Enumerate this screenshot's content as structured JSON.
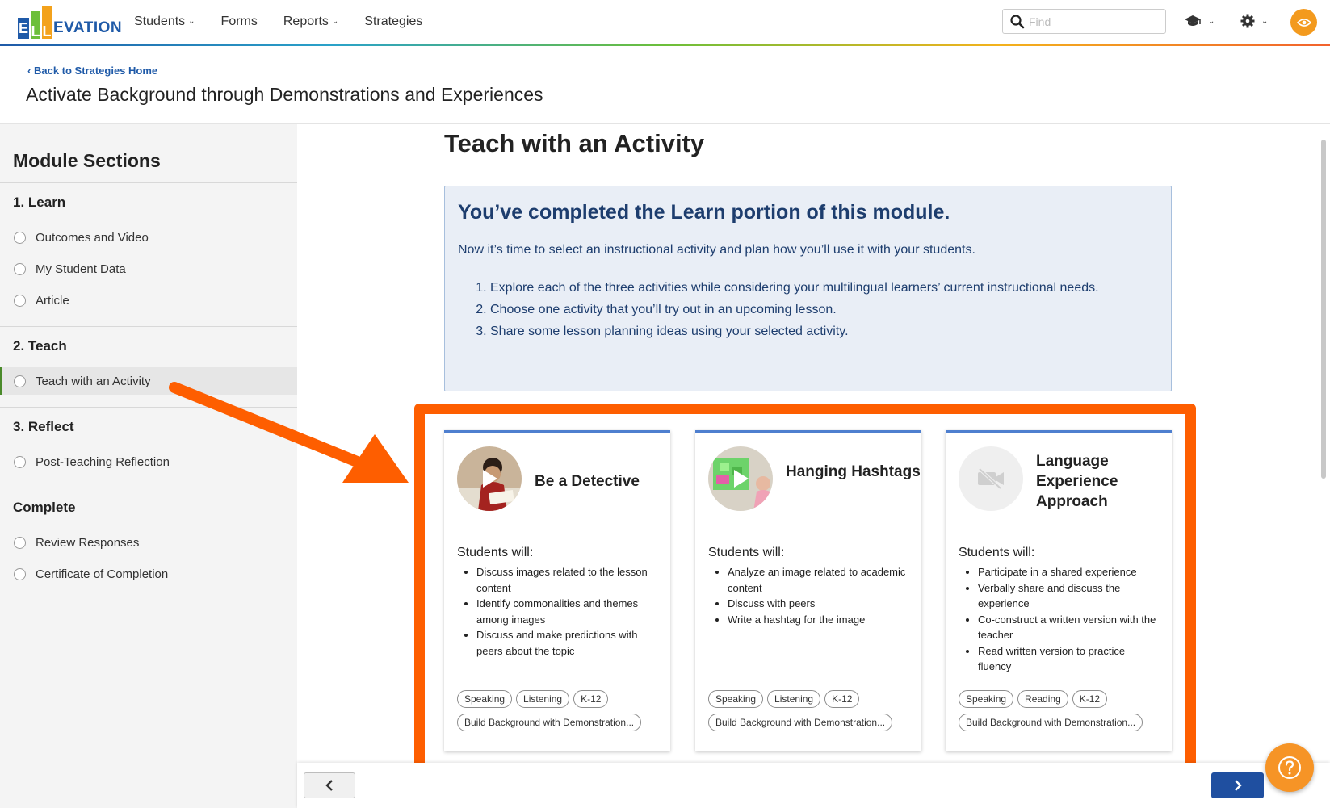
{
  "brand": {
    "logo_e": "E",
    "logo_l1": "L",
    "logo_l2": "L",
    "logo_rest": "EVATION",
    "accent": "#1f5aa8"
  },
  "nav": {
    "items": [
      {
        "label": "Students",
        "has_dropdown": true
      },
      {
        "label": "Forms",
        "has_dropdown": false
      },
      {
        "label": "Reports",
        "has_dropdown": true
      },
      {
        "label": "Strategies",
        "has_dropdown": false
      }
    ],
    "search": {
      "placeholder": "Find",
      "value": ""
    },
    "icons": [
      "graduation-cap-icon",
      "gear-icon",
      "eye-icon"
    ]
  },
  "header": {
    "back_link": "Back to Strategies Home",
    "title": "Activate Background through Demonstrations and Experiences"
  },
  "sidebar": {
    "title": "Module Sections",
    "sections": [
      {
        "title": "1. Learn",
        "items": [
          "Outcomes and Video",
          "My Student Data",
          "Article"
        ]
      },
      {
        "title": "2. Teach",
        "items": [
          "Teach with an Activity"
        ]
      },
      {
        "title": "3. Reflect",
        "items": [
          "Post-Teaching Reflection"
        ]
      },
      {
        "title": "Complete",
        "items": [
          "Review Responses",
          "Certificate of Completion"
        ]
      }
    ],
    "active_item": "Teach with an Activity"
  },
  "main": {
    "title": "Teach with an Activity",
    "info": {
      "heading": "You’ve completed the Learn portion of this module.",
      "intro": "Now it’s time to select an instructional activity and plan how you’ll use it with your students.",
      "steps": [
        "Explore each of the three activities while considering your multilingual learners’ current instructional needs.",
        "Choose one activity that you’ll try out in an upcoming lesson.",
        "Share some lesson planning ideas using your selected activity."
      ]
    },
    "cards": [
      {
        "name": "Be a Detective",
        "students_will": "Students will:",
        "bullets": [
          "Discuss images related to the lesson content",
          "Identify commonalities and themes among images",
          "Discuss and make predictions with peers about the topic"
        ],
        "tags": [
          "Speaking",
          "Listening",
          "K-12",
          "Build Background with Demonstration..."
        ]
      },
      {
        "name": "Hanging Hashtags",
        "students_will": "Students will:",
        "bullets": [
          "Analyze an image related to academic content",
          "Discuss with peers",
          "Write a hashtag for the image"
        ],
        "tags": [
          "Speaking",
          "Listening",
          "K-12",
          "Build Background with Demonstration..."
        ]
      },
      {
        "name": "Language Experience Approach",
        "students_will": "Students will:",
        "bullets": [
          "Participate in a shared experience",
          "Verbally share and discuss the experience",
          "Co-construct a written version with the teacher",
          "Read written version to practice fluency"
        ],
        "tags": [
          "Speaking",
          "Reading",
          "K-12",
          "Build Background with Demonstration..."
        ]
      }
    ]
  },
  "colors": {
    "highlight": "#fe5e00",
    "card_top": "#4e7fcf",
    "next_button": "#1f4fa0",
    "help_button": "#f69426",
    "info_text": "#1d3d6e"
  }
}
